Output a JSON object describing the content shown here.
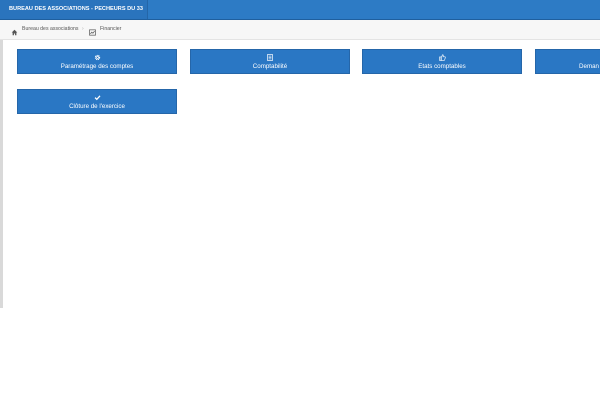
{
  "header": {
    "title": "BUREAU DES ASSOCIATIONS - PECHEURS DU 33"
  },
  "breadcrumb": {
    "items": [
      {
        "label": "Bureau des associations",
        "icon": "home-icon"
      },
      {
        "label": "Financier",
        "icon": "chart-icon"
      }
    ]
  },
  "tiles": [
    {
      "label": "Paramétrage des comptes",
      "icon": "gear-icon"
    },
    {
      "label": "Comptabilité",
      "icon": "ledger-icon"
    },
    {
      "label": "Etats comptables",
      "icon": "thumbs-up-icon"
    },
    {
      "label": "Deman",
      "icon": "unknown-icon"
    },
    {
      "label": "Clôture de l'exercice",
      "icon": "check-icon"
    }
  ],
  "colors": {
    "primary": "#2a77c4",
    "topbar": "#2d7bc5",
    "breadcrumb_bg": "#f7f7f7"
  }
}
